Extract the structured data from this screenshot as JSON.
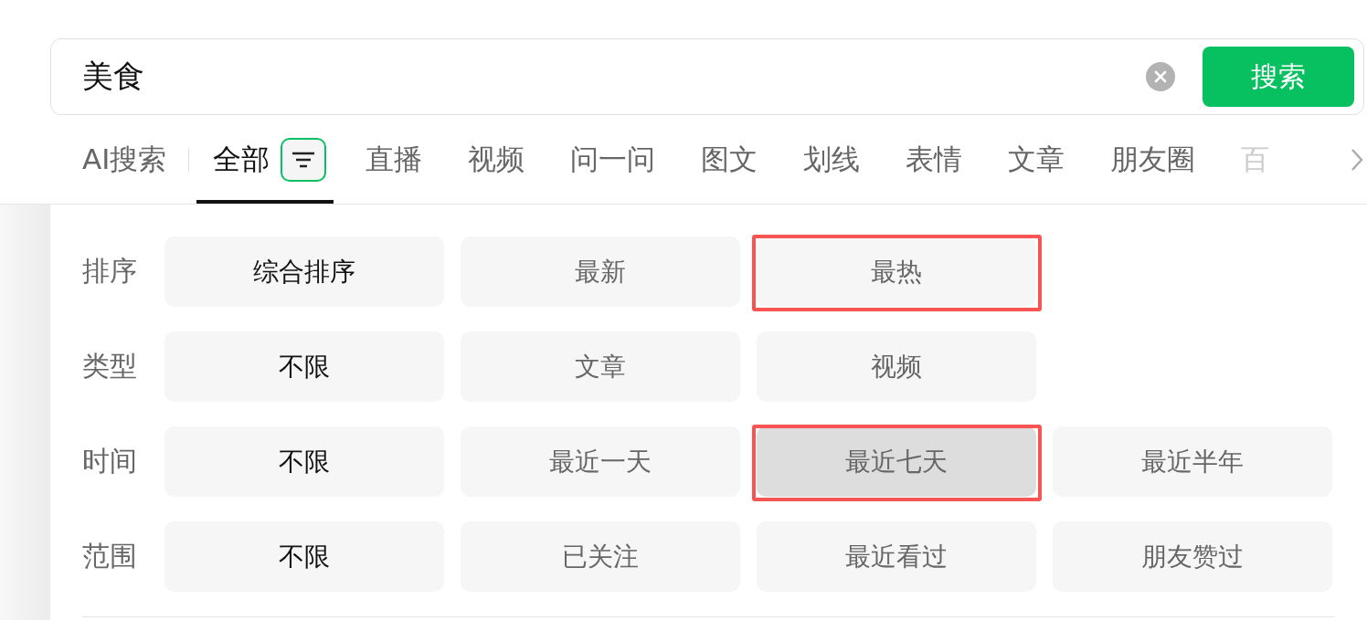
{
  "search": {
    "value": "美食",
    "button": "搜索"
  },
  "tabs": [
    {
      "label": "AI搜索",
      "selected": false,
      "kind": "ai"
    },
    {
      "label": "全部",
      "selected": true,
      "kind": "filter"
    },
    {
      "label": "直播",
      "selected": false,
      "kind": "plain"
    },
    {
      "label": "视频",
      "selected": false,
      "kind": "plain"
    },
    {
      "label": "问一问",
      "selected": false,
      "kind": "plain"
    },
    {
      "label": "图文",
      "selected": false,
      "kind": "plain"
    },
    {
      "label": "划线",
      "selected": false,
      "kind": "plain"
    },
    {
      "label": "表情",
      "selected": false,
      "kind": "plain"
    },
    {
      "label": "文章",
      "selected": false,
      "kind": "plain"
    },
    {
      "label": "朋友圈",
      "selected": false,
      "kind": "plain"
    },
    {
      "label": "百",
      "selected": false,
      "kind": "faded"
    }
  ],
  "filters": [
    {
      "label": "排序",
      "options": [
        {
          "label": "综合排序",
          "selected": true,
          "hovered": false,
          "highlighted": false
        },
        {
          "label": "最新",
          "selected": false,
          "hovered": false,
          "highlighted": false
        },
        {
          "label": "最热",
          "selected": false,
          "hovered": false,
          "highlighted": true
        }
      ]
    },
    {
      "label": "类型",
      "options": [
        {
          "label": "不限",
          "selected": true,
          "hovered": false,
          "highlighted": false
        },
        {
          "label": "文章",
          "selected": false,
          "hovered": false,
          "highlighted": false
        },
        {
          "label": "视频",
          "selected": false,
          "hovered": false,
          "highlighted": false
        }
      ]
    },
    {
      "label": "时间",
      "options": [
        {
          "label": "不限",
          "selected": true,
          "hovered": false,
          "highlighted": false
        },
        {
          "label": "最近一天",
          "selected": false,
          "hovered": false,
          "highlighted": false
        },
        {
          "label": "最近七天",
          "selected": false,
          "hovered": true,
          "highlighted": true
        },
        {
          "label": "最近半年",
          "selected": false,
          "hovered": false,
          "highlighted": false
        }
      ]
    },
    {
      "label": "范围",
      "options": [
        {
          "label": "不限",
          "selected": true,
          "hovered": false,
          "highlighted": false
        },
        {
          "label": "已关注",
          "selected": false,
          "hovered": false,
          "highlighted": false
        },
        {
          "label": "最近看过",
          "selected": false,
          "hovered": false,
          "highlighted": false
        },
        {
          "label": "朋友赞过",
          "selected": false,
          "hovered": false,
          "highlighted": false
        }
      ]
    }
  ]
}
